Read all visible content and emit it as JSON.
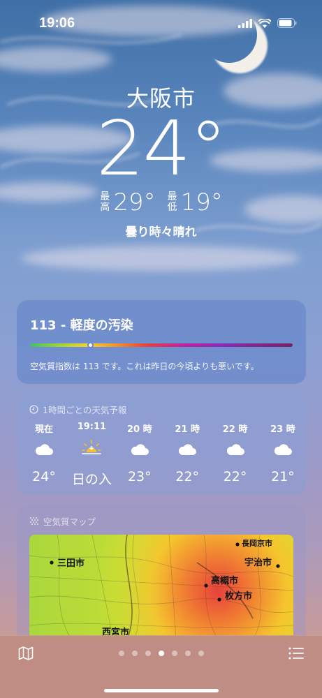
{
  "status": {
    "time": "19:06"
  },
  "location": {
    "city": "大阪市",
    "temperature": "24°",
    "high_label": "最高",
    "high": "29°",
    "low_label": "最低",
    "low": "19°",
    "condition": "曇り時々晴れ"
  },
  "aqi": {
    "title": "113 - 軽度の汚染",
    "value_fraction": 0.23,
    "description": "空気質指数は 113 です。これは昨日の今頃よりも悪いです。"
  },
  "hourly": {
    "heading": "1時間ごとの天気予報",
    "items": [
      {
        "time": "現在",
        "icon": "cloud-icon",
        "temp": "24°"
      },
      {
        "time": "19:11",
        "icon": "sunset-icon",
        "temp": "日の入"
      },
      {
        "time": "20 時",
        "icon": "cloud-icon",
        "temp": "23°"
      },
      {
        "time": "21 時",
        "icon": "cloud-icon",
        "temp": "22°"
      },
      {
        "time": "22 時",
        "icon": "cloud-icon",
        "temp": "22°"
      },
      {
        "time": "23 時",
        "icon": "cloud-icon",
        "temp": "21°"
      }
    ]
  },
  "air_map": {
    "heading": "空気質マップ",
    "places": [
      "三田市",
      "長岡京市",
      "宇治市",
      "高槻市",
      "枚方市",
      "西宮市"
    ]
  },
  "bottom": {
    "page_count": 7,
    "active_page": 4
  }
}
